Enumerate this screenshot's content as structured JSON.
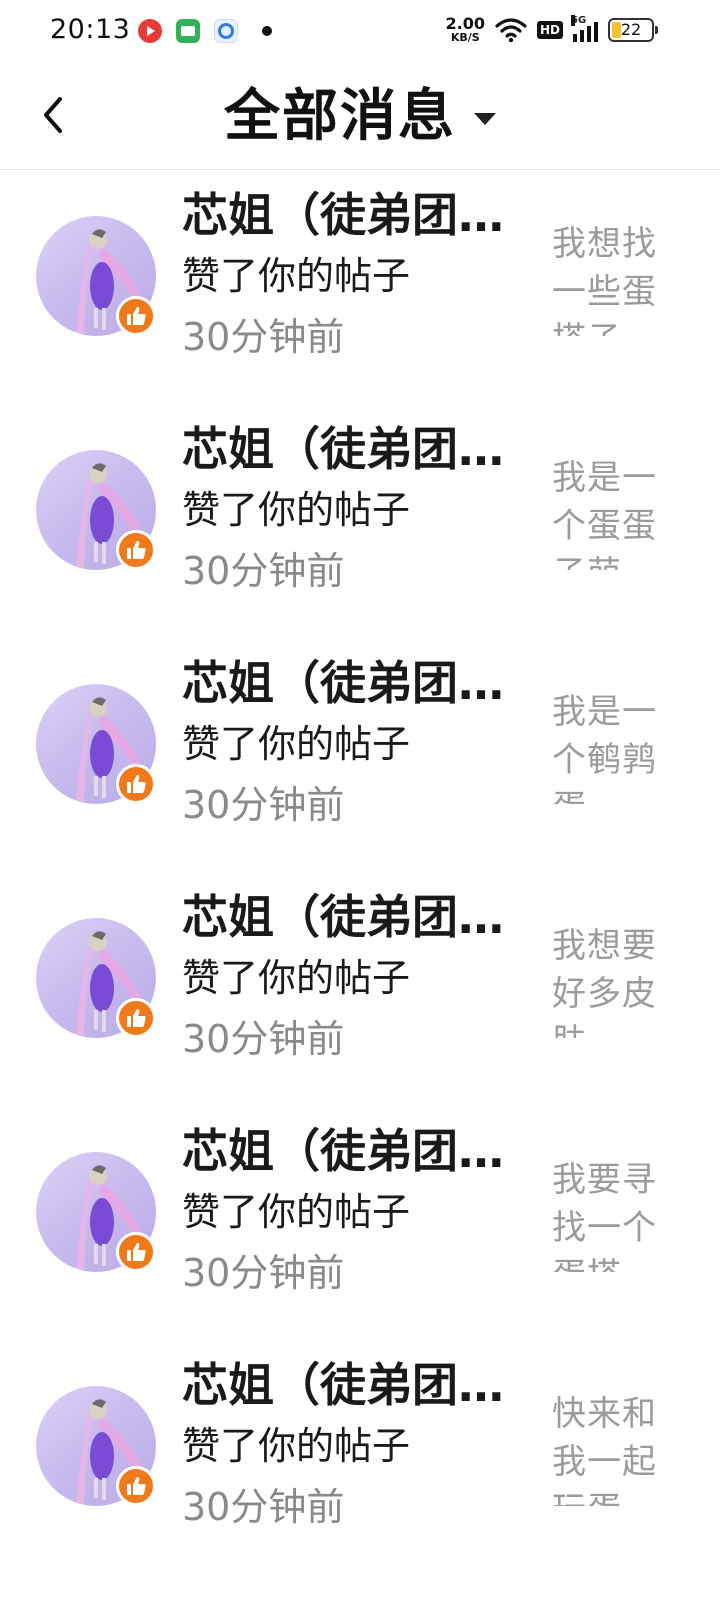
{
  "status_bar": {
    "time": "20:13",
    "net_speed_value": "2.00",
    "net_speed_unit": "KB/S",
    "hd_label": "HD",
    "network_label": "5G",
    "battery": "22"
  },
  "header": {
    "title": "全部消息"
  },
  "messages": [
    {
      "name": "芯姐（徒弟团…",
      "action": "赞了你的帖子",
      "time": "30分钟前",
      "preview": "我想找一些蛋搭子"
    },
    {
      "name": "芯姐（徒弟团…",
      "action": "赞了你的帖子",
      "time": "30分钟前",
      "preview": "我是一个蛋蛋子萌"
    },
    {
      "name": "芯姐（徒弟团…",
      "action": "赞了你的帖子",
      "time": "30分钟前",
      "preview": "我是一个鹌鹑蛋"
    },
    {
      "name": "芯姐（徒弟团…",
      "action": "赞了你的帖子",
      "time": "30分钟前",
      "preview": "我想要好多皮肤"
    },
    {
      "name": "芯姐（徒弟团…",
      "action": "赞了你的帖子",
      "time": "30分钟前",
      "preview": "我要寻找一个蛋搭"
    },
    {
      "name": "芯姐（徒弟团…",
      "action": "赞了你的帖子",
      "time": "30分钟前",
      "preview": "快来和我一起玩蛋"
    }
  ],
  "colors": {
    "like_badge": "#f07a1a",
    "avatar_bg": "#c9bcee",
    "time_text": "#8a8a8a",
    "preview_text": "#9b9b9b"
  },
  "icons": {
    "back": "back-arrow-icon",
    "dropdown": "caret-down-icon",
    "like": "thumbs-up-icon"
  }
}
